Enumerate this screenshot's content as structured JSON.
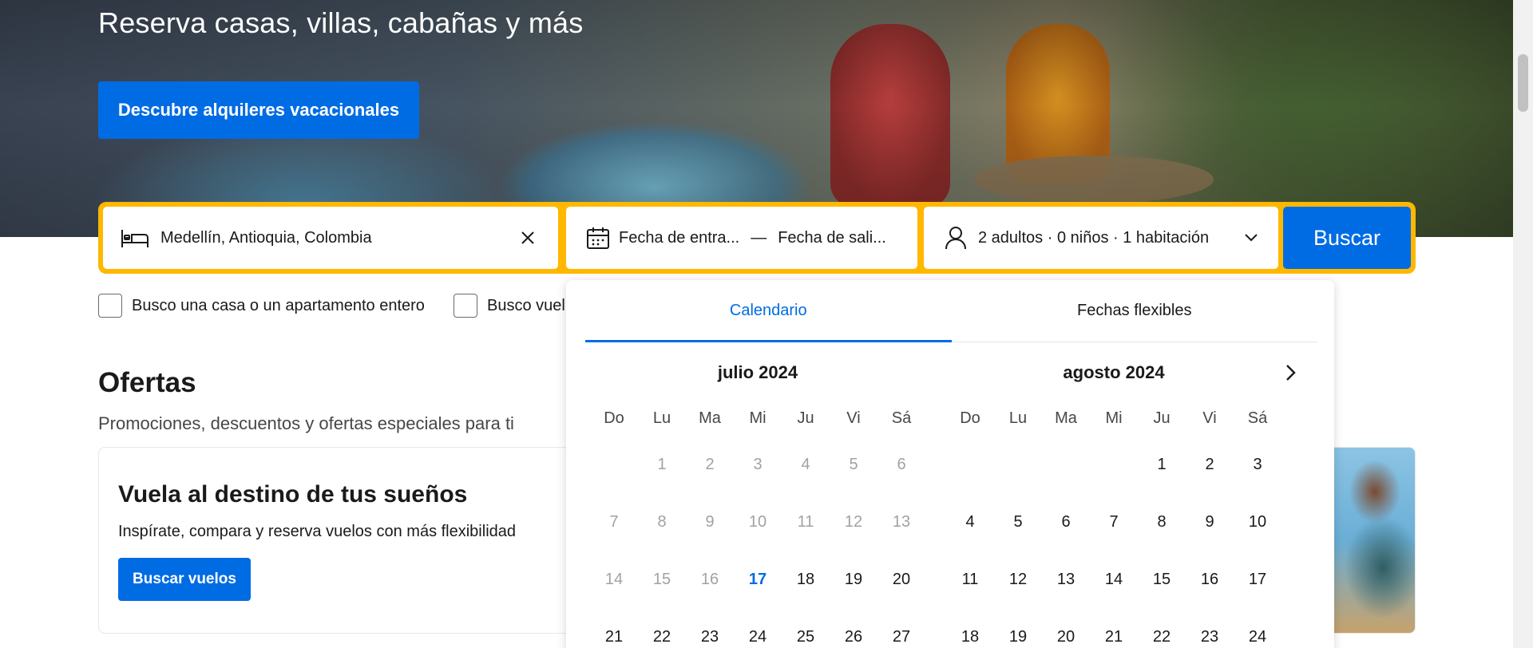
{
  "hero": {
    "title": "Reserva casas, villas, cabañas y más",
    "cta_label": "Descubre alquileres vacacionales"
  },
  "search": {
    "destination": "Medellín, Antioquia, Colombia",
    "checkin_label": "Fecha de entra...",
    "date_separator": "—",
    "checkout_label": "Fecha de sali...",
    "guests": "2 adultos · 0 niños · 1 habitación",
    "button_label": "Buscar",
    "icons": {
      "destination": "bed-icon",
      "clear": "close-icon",
      "dates": "calendar-icon",
      "guests": "person-icon",
      "dropdown": "chevron-down-icon"
    }
  },
  "filters": {
    "whole_home": "Busco una casa o un apartamento entero",
    "flights": "Busco vuel"
  },
  "offers": {
    "title": "Ofertas",
    "subtitle": "Promociones, descuentos y ofertas especiales para ti",
    "card": {
      "title": "Vuela al destino de tus sueños",
      "subtitle": "Inspírate, compara y reserva vuelos con más flexibilidad",
      "button_label": "Buscar vuelos"
    }
  },
  "calendar": {
    "tabs": [
      {
        "label": "Calendario",
        "active": true
      },
      {
        "label": "Fechas flexibles",
        "active": false
      }
    ],
    "weekdays": [
      "Do",
      "Lu",
      "Ma",
      "Mi",
      "Ju",
      "Vi",
      "Sá"
    ],
    "today": 17,
    "months": [
      {
        "title": "julio 2024",
        "days": [
          "",
          "1",
          "2",
          "3",
          "4",
          "5",
          "6",
          "7",
          "8",
          "9",
          "10",
          "11",
          "12",
          "13",
          "14",
          "15",
          "16",
          "17",
          "18",
          "19",
          "20",
          "21",
          "22",
          "23",
          "24",
          "25",
          "26",
          "27"
        ],
        "past_until": 16
      },
      {
        "title": "agosto 2024",
        "days": [
          "",
          "",
          "",
          "",
          "1",
          "2",
          "3",
          "4",
          "5",
          "6",
          "7",
          "8",
          "9",
          "10",
          "11",
          "12",
          "13",
          "14",
          "15",
          "16",
          "17",
          "18",
          "19",
          "20",
          "21",
          "22",
          "23",
          "24"
        ],
        "past_until": 0
      }
    ],
    "next_icon": "chevron-right-icon"
  },
  "colors": {
    "primary": "#006ce4",
    "searchbar_border": "#ffb700",
    "text": "#1a1a1a",
    "muted": "#a2a2a2"
  }
}
